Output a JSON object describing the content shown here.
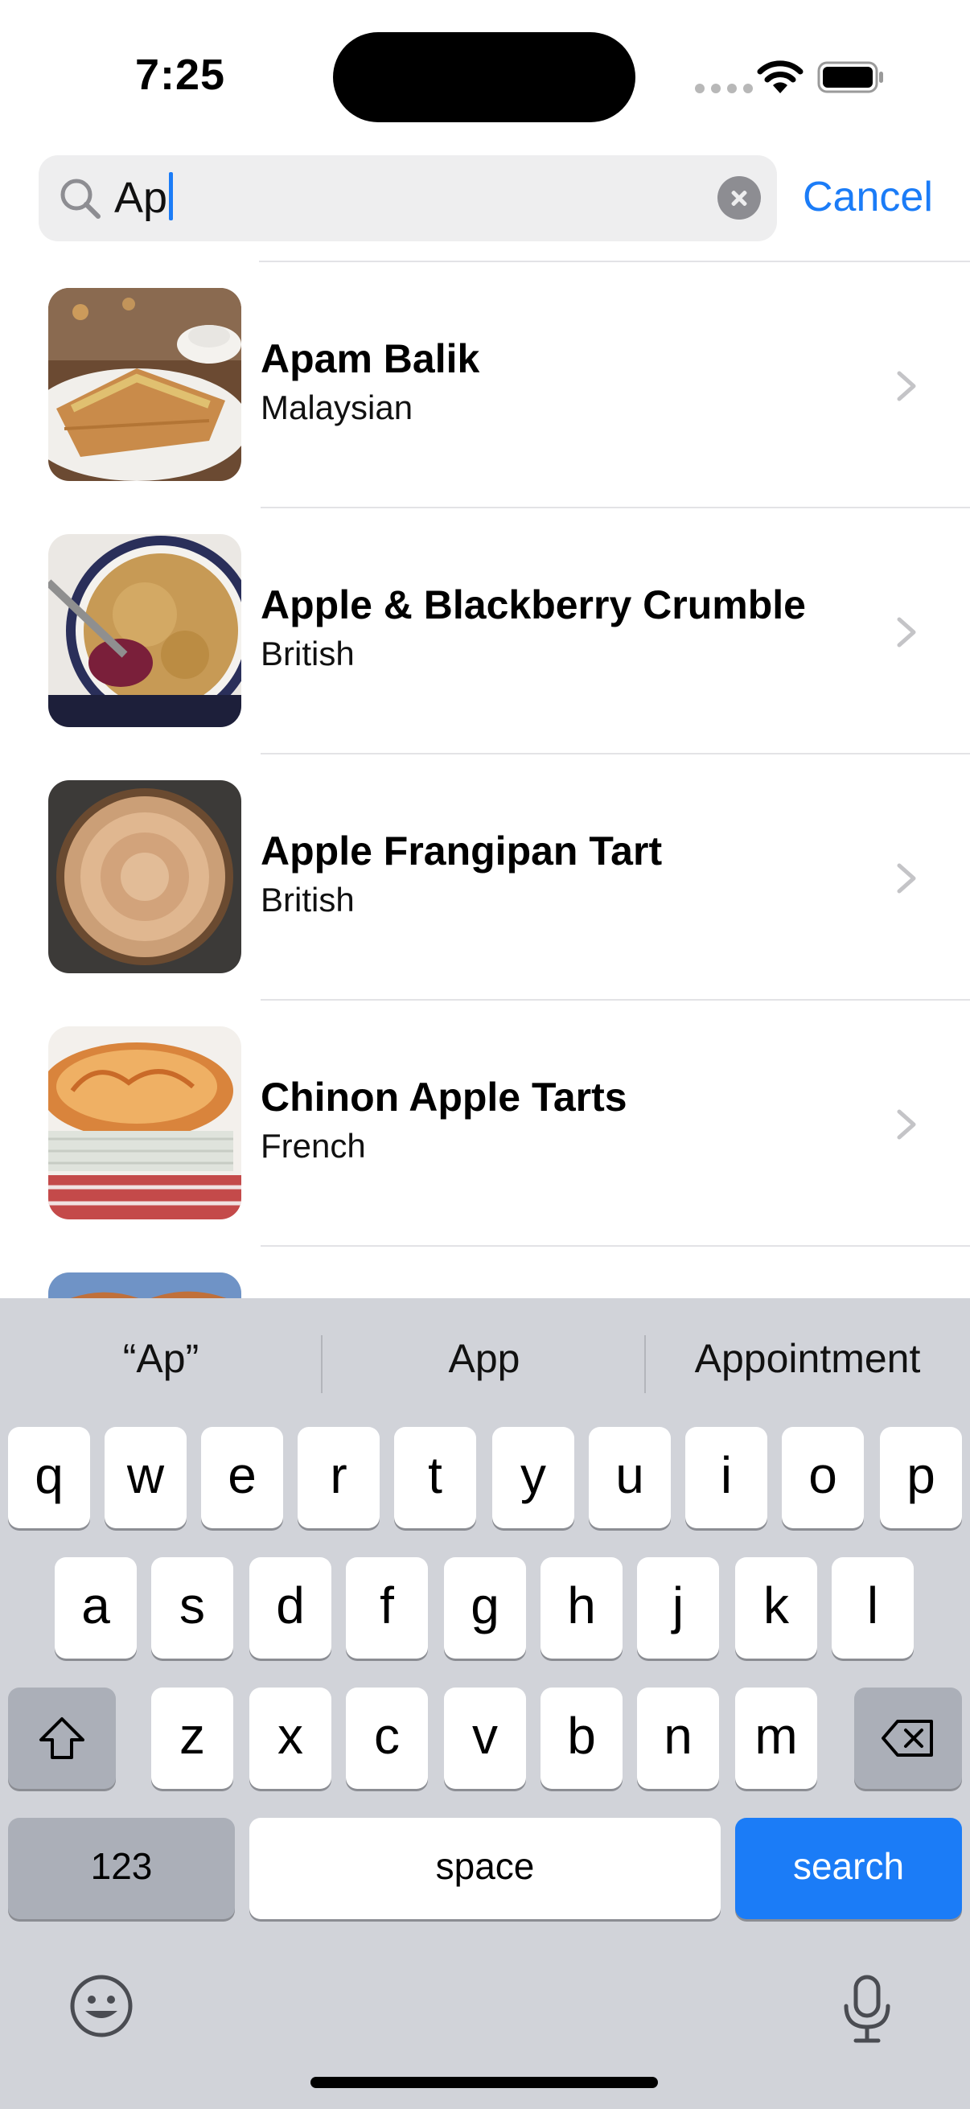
{
  "status_bar": {
    "time": "7:25",
    "wifi_icon": "wifi-icon",
    "battery_icon": "battery-icon"
  },
  "search": {
    "query": "Ap",
    "cancel_label": "Cancel"
  },
  "results": [
    {
      "title": "Apam Balik",
      "subtitle": "Malaysian",
      "image": "apam-balik-photo"
    },
    {
      "title": "Apple & Blackberry Crumble",
      "subtitle": "British",
      "image": "crumble-photo"
    },
    {
      "title": "Apple Frangipan Tart",
      "subtitle": "British",
      "image": "frangipan-tart-photo"
    },
    {
      "title": "Chinon Apple Tarts",
      "subtitle": "French",
      "image": "chinon-tart-photo"
    }
  ],
  "keyboard": {
    "suggestions": [
      "“Ap”",
      "App",
      "Appointment"
    ],
    "row1": [
      "q",
      "w",
      "e",
      "r",
      "t",
      "y",
      "u",
      "i",
      "o",
      "p"
    ],
    "row2": [
      "a",
      "s",
      "d",
      "f",
      "g",
      "h",
      "j",
      "k",
      "l"
    ],
    "row3": [
      "z",
      "x",
      "c",
      "v",
      "b",
      "n",
      "m"
    ],
    "numbers_label": "123",
    "space_label": "space",
    "search_label": "search"
  },
  "colors": {
    "accent": "#1b7cf7",
    "keyboard_bg": "#d1d3d9",
    "search_field_bg": "#eeeeef"
  }
}
